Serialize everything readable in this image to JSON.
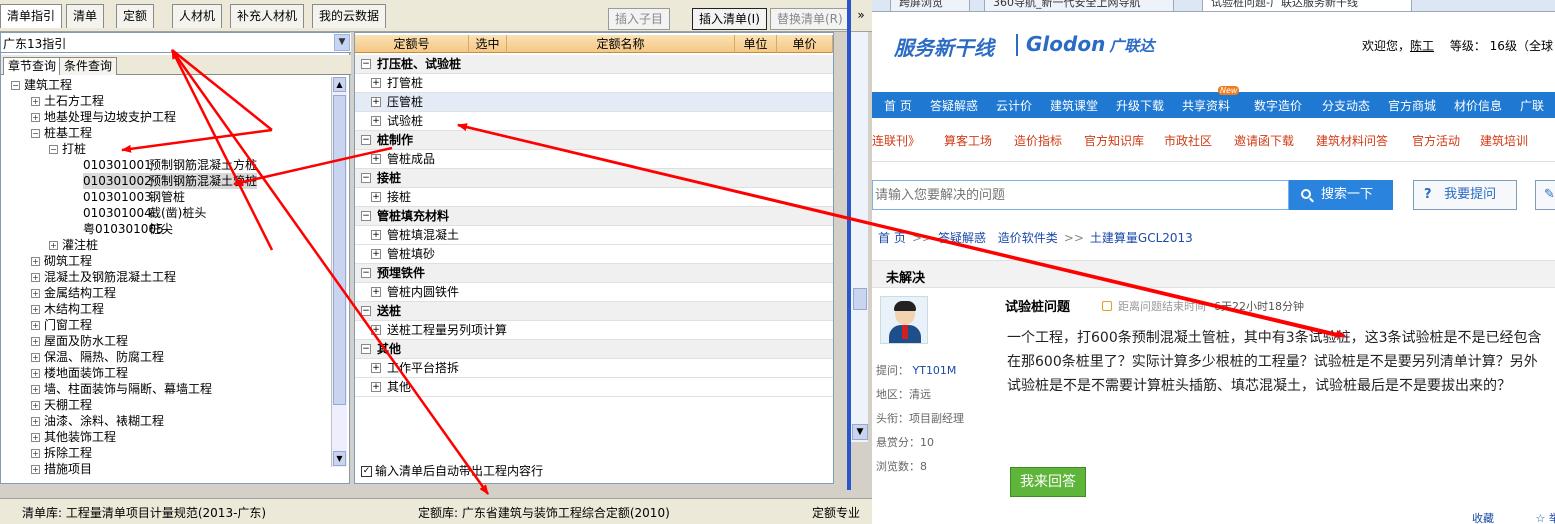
{
  "app": {
    "tabs": [
      "清单指引",
      "清单",
      "定额",
      "人材机",
      "补充人材机",
      "我的云数据"
    ],
    "buttons": {
      "insert_child": "插入子目",
      "insert_list": "插入清单(I)",
      "replace_list": "替换清单(R)"
    },
    "dictionary_select": "广东13指引",
    "subtabs": [
      "章节查询",
      "条件查询"
    ],
    "tree": [
      {
        "label": "建筑工程",
        "toggle": "⊟",
        "level": 0
      },
      {
        "label": "土石方工程",
        "toggle": "⊞",
        "level": 1
      },
      {
        "label": "地基处理与边坡支护工程",
        "toggle": "⊞",
        "level": 1
      },
      {
        "label": "桩基工程",
        "toggle": "⊟",
        "level": 1
      },
      {
        "label": "打桩",
        "toggle": "⊟",
        "level": 2
      },
      {
        "code": "010301001",
        "label": "预制钢筋混凝土方桩",
        "level": 3
      },
      {
        "code": "010301002",
        "label": "预制钢筋混凝土管桩",
        "level": 3
      },
      {
        "code": "010301003",
        "label": "钢管桩",
        "level": 3
      },
      {
        "code": "010301004",
        "label": "截(凿)桩头",
        "level": 3
      },
      {
        "code": "粤010301005",
        "label": "桩尖",
        "level": 3
      },
      {
        "label": "灌注桩",
        "toggle": "⊞",
        "level": 2
      },
      {
        "label": "砌筑工程",
        "toggle": "⊞",
        "level": 1
      },
      {
        "label": "混凝土及钢筋混凝土工程",
        "toggle": "⊞",
        "level": 1
      },
      {
        "label": "金属结构工程",
        "toggle": "⊞",
        "level": 1
      },
      {
        "label": "木结构工程",
        "toggle": "⊞",
        "level": 1
      },
      {
        "label": "门窗工程",
        "toggle": "⊞",
        "level": 1
      },
      {
        "label": "屋面及防水工程",
        "toggle": "⊞",
        "level": 1
      },
      {
        "label": "保温、隔热、防腐工程",
        "toggle": "⊞",
        "level": 1
      },
      {
        "label": "楼地面装饰工程",
        "toggle": "⊞",
        "level": 1
      },
      {
        "label": "墙、柱面装饰与隔断、幕墙工程",
        "toggle": "⊞",
        "level": 1
      },
      {
        "label": "天棚工程",
        "toggle": "⊞",
        "level": 1
      },
      {
        "label": "油漆、涂料、裱糊工程",
        "toggle": "⊞",
        "level": 1
      },
      {
        "label": "其他装饰工程",
        "toggle": "⊞",
        "level": 1
      },
      {
        "label": "拆除工程",
        "toggle": "⊞",
        "level": 1
      },
      {
        "label": "措施项目",
        "toggle": "⊞",
        "level": 1
      }
    ],
    "grid_headers": [
      "定额号",
      "选中",
      "定额名称",
      "单位",
      "单价"
    ],
    "grid_rows": [
      {
        "label": "打压桩、试验桩",
        "group": true,
        "toggle": "−"
      },
      {
        "label": "打管桩",
        "toggle": "+"
      },
      {
        "label": "压管桩",
        "toggle": "+",
        "highlight": true
      },
      {
        "label": "试验桩",
        "toggle": "+"
      },
      {
        "label": "桩制作",
        "group": true,
        "toggle": "−"
      },
      {
        "label": "管桩成品",
        "toggle": "+"
      },
      {
        "label": "接桩",
        "group": true,
        "toggle": "−"
      },
      {
        "label": "接桩",
        "toggle": "+"
      },
      {
        "label": "管桩填充材料",
        "group": true,
        "toggle": "−"
      },
      {
        "label": "管桩填混凝土",
        "toggle": "+"
      },
      {
        "label": "管桩填砂",
        "toggle": "+"
      },
      {
        "label": "预埋铁件",
        "group": true,
        "toggle": "−"
      },
      {
        "label": "管桩内圆铁件",
        "toggle": "+"
      },
      {
        "label": "送桩",
        "group": true,
        "toggle": "−"
      },
      {
        "label": "送桩工程量另列项计算",
        "toggle": "+"
      },
      {
        "label": "其他",
        "group": true,
        "toggle": "−"
      },
      {
        "label": "工作平台搭拆",
        "toggle": "+"
      },
      {
        "label": "其他",
        "toggle": "+"
      }
    ],
    "auto_check_label": "输入清单后自动带出工程内容行",
    "status": {
      "list_lib": "清单库:  工程量清单项目计量规范(2013-广东)",
      "quota_lib": "定额库:  广东省建筑与装饰工程综合定额(2010)",
      "quota_major": "定额专业"
    }
  },
  "browser": {
    "tabs": [
      "跨屏浏览",
      "360导航_新一代安全上网导航",
      "试验桩问题-广联达服务新干线"
    ],
    "logo_text_1": "服务新干线",
    "logo_text_2": "Glodon",
    "logo_text_2_cn": "广联达",
    "welcome": {
      "prefix": "欢迎您，",
      "user": "陈工",
      "level": "等级：  16级（全球"
    },
    "nav1": [
      "首 页",
      "答疑解惑",
      "云计价",
      "建筑课堂",
      "升级下载",
      "共享资料",
      "数字造价",
      "分支动态",
      "官方商城",
      "材价信息",
      "广联"
    ],
    "new_badge": "New",
    "nav2": [
      "连联刊》",
      "算客工场",
      "造价指标",
      "官方知识库",
      "市政社区",
      "邀请函下载",
      "建筑材料问答",
      "官方活动",
      "建筑培训"
    ],
    "search": {
      "placeholder": "请输入您要解决的问题",
      "button": "搜索一下",
      "ask_button": "我要提问",
      "ask_icon": "?"
    },
    "breadcrumb": [
      "首 页",
      "答疑解惑",
      "造价软件类",
      "土建算量GCL2013"
    ],
    "unsolved": "未解决",
    "question": {
      "title": "试验桩问题",
      "timer_label": "距离问题结束时间",
      "timer_value": "6天22小时18分钟",
      "body": "一个工程，打600条预制混凝土管桩，其中有3条试验桩，这3条试验桩是不是已经包含在那600条桩里了？实际计算多少根桩的工程量？试验桩是不是要另列清单计算？另外试验桩是不是不需要计算桩头插筋、填芯混凝土，试验桩最后是不是要拔出来的？"
    },
    "meta": {
      "asker_label": "提问：",
      "asker": "YT101M",
      "region": "地区：清远",
      "title": "头衔：项目副经理",
      "reward": "悬赏分：10",
      "views": "浏览数：8"
    },
    "answer_button": "我来回答",
    "footer": [
      "收藏",
      "举"
    ]
  },
  "colors": {
    "arrow": "#ff0000",
    "nav_blue": "#1f78d1",
    "answer_green": "#5fb53a"
  }
}
